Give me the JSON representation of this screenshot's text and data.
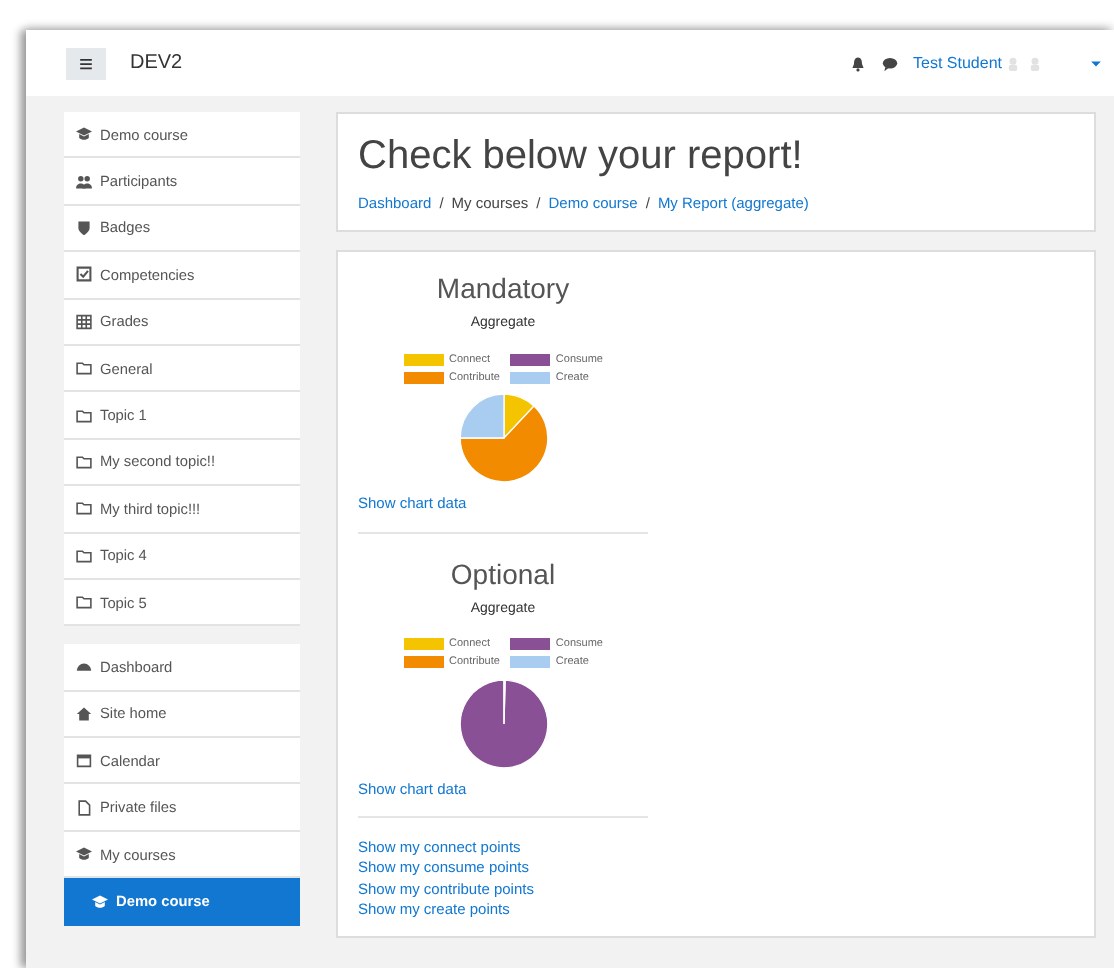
{
  "navbar": {
    "menu_icon": "≡",
    "site_name": "DEV2",
    "user_name": "Test Student"
  },
  "sidebar": {
    "groups": [
      {
        "items": [
          {
            "label": "Demo course",
            "selected": false
          },
          {
            "label": "Participants",
            "selected": false
          },
          {
            "label": "Badges",
            "selected": false
          },
          {
            "label": "Competencies",
            "selected": false
          },
          {
            "label": "Grades",
            "selected": false
          },
          {
            "label": "General",
            "selected": false
          },
          {
            "label": "Topic 1",
            "selected": false
          },
          {
            "label": "My second topic!!",
            "selected": false
          },
          {
            "label": "My third topic!!!",
            "selected": false
          },
          {
            "label": "Topic 4",
            "selected": false
          },
          {
            "label": "Topic 5",
            "selected": false
          }
        ]
      },
      {
        "items": [
          {
            "label": "Dashboard",
            "selected": false
          },
          {
            "label": "Site home",
            "selected": false
          },
          {
            "label": "Calendar",
            "selected": false
          },
          {
            "label": "Private files",
            "selected": false
          },
          {
            "label": "My courses",
            "selected": false
          },
          {
            "label": "Demo course",
            "selected": true
          }
        ]
      }
    ]
  },
  "header": {
    "title": "Check below your report!",
    "separator": "/",
    "breadcrumb": [
      {
        "label": "Dashboard",
        "link": true
      },
      {
        "label": "My courses",
        "link": false
      },
      {
        "label": "Demo course",
        "link": true
      },
      {
        "label": "My Report (aggregate)",
        "link": true
      }
    ]
  },
  "charts": [
    {
      "title": "Mandatory",
      "subtitle": "Aggregate",
      "legend": [
        {
          "label": "Connect",
          "color": "#f5c400"
        },
        {
          "label": "Consume",
          "color": "#8a5096"
        },
        {
          "label": "Contribute",
          "color": "#f38b00"
        },
        {
          "label": "Create",
          "color": "#a8cdf0"
        }
      ],
      "link": "Show chart data"
    },
    {
      "title": "Optional",
      "subtitle": "Aggregate",
      "legend": [
        {
          "label": "Connect",
          "color": "#f5c400"
        },
        {
          "label": "Consume",
          "color": "#8a5096"
        },
        {
          "label": "Contribute",
          "color": "#f38b00"
        },
        {
          "label": "Create",
          "color": "#a8cdf0"
        }
      ],
      "link": "Show chart data"
    }
  ],
  "points_links": [
    "Show my connect points",
    "Show my consume points",
    "Show my contribute points",
    "Show my create points"
  ]
}
